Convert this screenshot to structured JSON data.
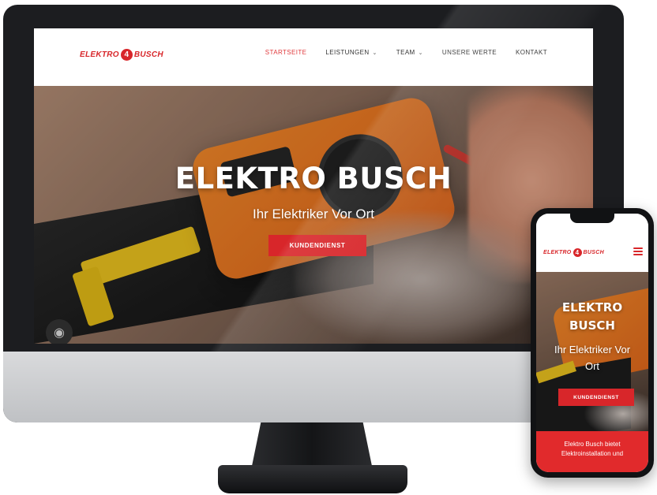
{
  "desktop": {
    "logo": {
      "text_left": "ELEKTRO",
      "bolt": "4",
      "text_right": "BUSCH"
    },
    "nav": [
      {
        "label": "STARTSEITE",
        "dropdown": false,
        "active": true
      },
      {
        "label": "LEISTUNGEN",
        "dropdown": true,
        "active": false
      },
      {
        "label": "TEAM",
        "dropdown": true,
        "active": false
      },
      {
        "label": "UNSERE WERTE",
        "dropdown": false,
        "active": false
      },
      {
        "label": "KONTAKT",
        "dropdown": false,
        "active": false
      }
    ],
    "hero": {
      "title": "ELEKTRO BUSCH",
      "subtitle": "Ihr Elektriker Vor Ort",
      "cta": "KUNDENDIENST"
    },
    "fingerprint_icon": "fingerprint-icon"
  },
  "mobile": {
    "logo": {
      "text_left": "ELEKTRO",
      "bolt": "4",
      "text_right": "BUSCH"
    },
    "menu_icon": "hamburger-menu-icon",
    "hero": {
      "title_line1": "ELEKTRO",
      "title_line2": "BUSCH",
      "subtitle_line1": "Ihr Elektriker Vor",
      "subtitle_line2": "Ort",
      "cta": "KUNDENDIENST"
    },
    "intro_line1": "Elektro Busch bietet",
    "intro_line2": "Elektroinstallation und"
  },
  "colors": {
    "brand_red": "#d8262a",
    "nav_active": "#e0393c",
    "monitor_bezel": "#1c1d20"
  }
}
